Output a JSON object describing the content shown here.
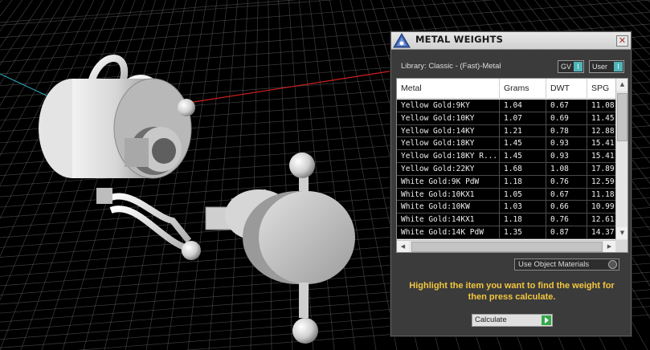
{
  "panel": {
    "title": "METAL WEIGHTS",
    "close_label": "✕",
    "library_label": "Library: Classic - (Fast)-Metal",
    "toggles": [
      {
        "label": "GV",
        "indicator": "I"
      },
      {
        "label": "User",
        "indicator": "I"
      }
    ],
    "table": {
      "columns": [
        "Metal",
        "Grams",
        "DWT",
        "SPG"
      ],
      "rows": [
        [
          "Yellow Gold:9KY",
          "1.04",
          "0.67",
          "11.08"
        ],
        [
          "Yellow Gold:10KY",
          "1.07",
          "0.69",
          "11.45"
        ],
        [
          "Yellow Gold:14KY",
          "1.21",
          "0.78",
          "12.88"
        ],
        [
          "Yellow Gold:18KY",
          "1.45",
          "0.93",
          "15.41"
        ],
        [
          "Yellow Gold:18KY R...",
          "1.45",
          "0.93",
          "15.41"
        ],
        [
          "Yellow Gold:22KY",
          "1.68",
          "1.08",
          "17.89"
        ],
        [
          "White Gold:9K PdW",
          "1.18",
          "0.76",
          "12.59"
        ],
        [
          "White Gold:10KX1",
          "1.05",
          "0.67",
          "11.18"
        ],
        [
          "White Gold:10KW",
          "1.03",
          "0.66",
          "10.99"
        ],
        [
          "White Gold:14KX1",
          "1.18",
          "0.76",
          "12.61"
        ],
        [
          "White Gold:14K PdW",
          "1.35",
          "0.87",
          "14.37"
        ]
      ]
    },
    "use_object_materials": "Use Object Materials",
    "hint": "Highlight the item you want to find the weight for then press calculate.",
    "calculate_label": "Calculate"
  },
  "colors": {
    "axis_red": "#d02020",
    "axis_cyan": "#2aa0b0",
    "hint_yellow": "#f3c63f",
    "accent_teal": "#4fb4b8"
  }
}
